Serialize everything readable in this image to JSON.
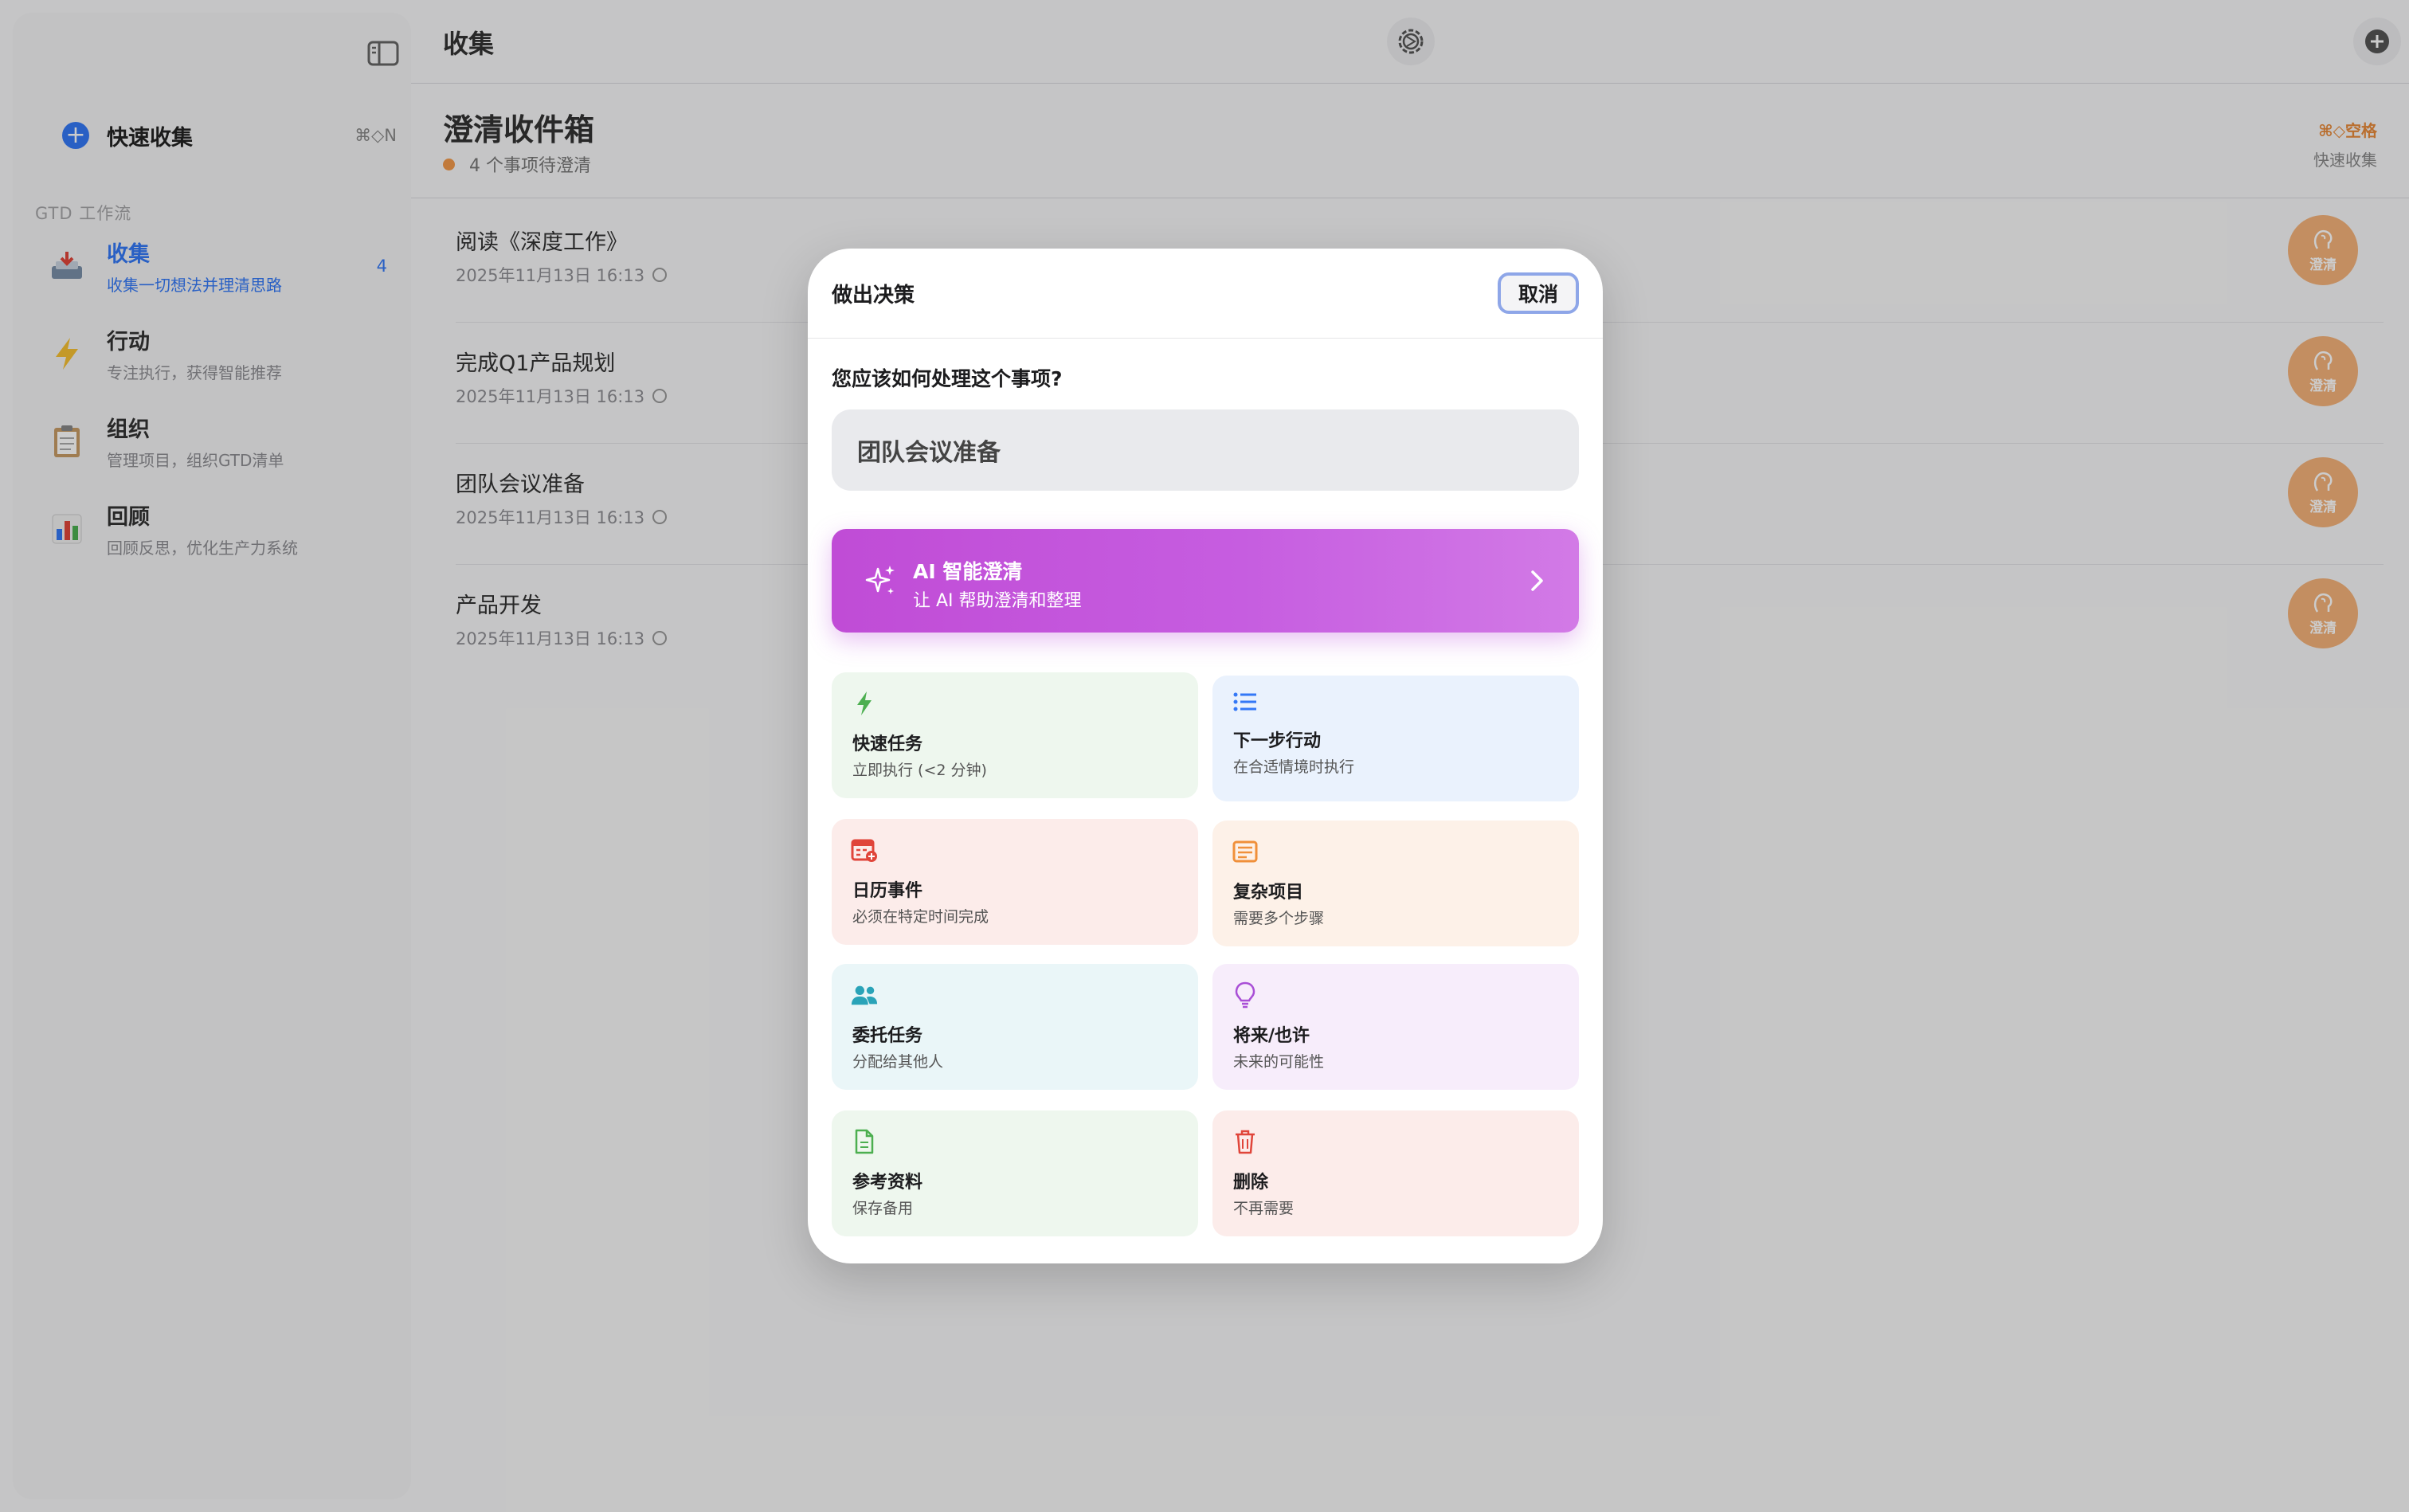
{
  "sidebar": {
    "quick_capture_label": "快速收集",
    "quick_capture_shortcut": "⌘◇N",
    "section_label": "GTD 工作流",
    "items": [
      {
        "title": "收集",
        "subtitle": "收集一切想法并理清思路",
        "badge": "4",
        "icon": "inbox-tray-icon"
      },
      {
        "title": "行动",
        "subtitle": "专注执行，获得智能推荐",
        "icon": "lightning-icon"
      },
      {
        "title": "组织",
        "subtitle": "管理项目，组织GTD清单",
        "icon": "clipboard-icon"
      },
      {
        "title": "回顾",
        "subtitle": "回顾反思，优化生产力系统",
        "icon": "bar-chart-icon"
      }
    ]
  },
  "topbar": {
    "title": "收集"
  },
  "header": {
    "title": "澄清收件箱",
    "subtitle": "4 个事项待澄清",
    "shortcut": "⌘◇空格",
    "shortcut_label": "快速收集"
  },
  "tasks": [
    {
      "title": "阅读《深度工作》",
      "date": "2025年11月13日 16:13",
      "action": "澄清"
    },
    {
      "title": "完成Q1产品规划",
      "date": "2025年11月13日 16:13",
      "action": "澄清"
    },
    {
      "title": "团队会议准备",
      "date": "2025年11月13日 16:13",
      "action": "澄清"
    },
    {
      "title": "产品开发",
      "date": "2025年11月13日 16:13",
      "action": "澄清"
    }
  ],
  "modal": {
    "title": "做出决策",
    "cancel_label": "取消",
    "question": "您应该如何处理这个事项?",
    "item_name": "团队会议准备",
    "ai": {
      "title": "AI 智能澄清",
      "subtitle": "让 AI 帮助澄清和整理"
    },
    "options": [
      {
        "title": "快速任务",
        "subtitle": "立即执行 (<2 分钟)",
        "icon": "lightning-icon",
        "color": "#4caf50"
      },
      {
        "title": "下一步行动",
        "subtitle": "在合适情境时执行",
        "icon": "list-icon",
        "color": "#3478f6"
      },
      {
        "title": "日历事件",
        "subtitle": "必须在特定时间完成",
        "icon": "calendar-icon",
        "color": "#e0453a"
      },
      {
        "title": "复杂项目",
        "subtitle": "需要多个步骤",
        "icon": "project-icon",
        "color": "#f0903a"
      },
      {
        "title": "委托任务",
        "subtitle": "分配给其他人",
        "icon": "people-icon",
        "color": "#2aa3b8"
      },
      {
        "title": "将来/也许",
        "subtitle": "未来的可能性",
        "icon": "lightbulb-icon",
        "color": "#a94fd6"
      },
      {
        "title": "参考资料",
        "subtitle": "保存备用",
        "icon": "document-icon",
        "color": "#4caf50"
      },
      {
        "title": "删除",
        "subtitle": "不再需要",
        "icon": "trash-icon",
        "color": "#e0453a"
      }
    ]
  }
}
